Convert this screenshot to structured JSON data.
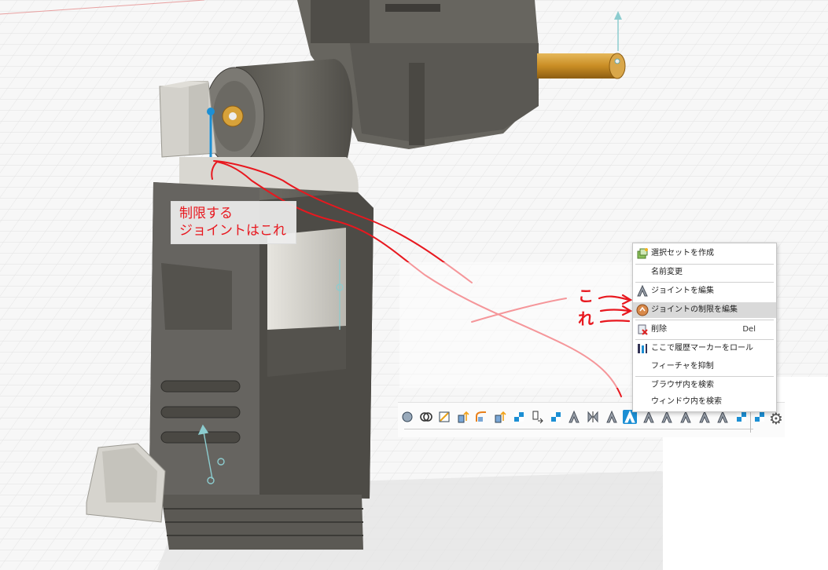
{
  "annotation": {
    "line1": "制限する",
    "line2": "ジョイントはこれ",
    "side_label_top": "こ",
    "side_label_bottom": "れ",
    "color": "#e8181f"
  },
  "context_menu": {
    "items": [
      {
        "label": "選択セットを作成",
        "icon": "selection-set-icon"
      },
      {
        "label": "名前変更",
        "icon": ""
      },
      {
        "label": "ジョイントを編集",
        "icon": "joint-icon"
      },
      {
        "label": "ジョイントの制限を編集",
        "icon": "joint-limits-icon",
        "highlighted": true
      },
      {
        "label": "削除",
        "shortcut": "Del",
        "icon": "delete-icon"
      },
      {
        "label": "ここで履歴マーカーをロール",
        "icon": "roll-marker-icon"
      },
      {
        "label": "フィーチャを抑制",
        "icon": ""
      },
      {
        "label": "ブラウザ内を検索",
        "icon": ""
      },
      {
        "label": "ウィンドウ内を検索",
        "icon": ""
      }
    ]
  },
  "timeline": {
    "icons": [
      "revolve-icon",
      "combine-icon",
      "sketch-icon",
      "extrude-icon",
      "fillet-icon",
      "extrude-icon",
      "joint-origin-icon",
      "move-icon",
      "joint-origin-icon",
      "joint-icon",
      "mirror-icon",
      "joint-icon",
      "joint-icon",
      "joint-icon",
      "joint-icon",
      "joint-icon",
      "joint-icon",
      "joint-icon",
      "joint-origin-icon",
      "joint-origin-icon"
    ],
    "selected_index": 12,
    "settings_icon": "gear-icon"
  },
  "colors": {
    "body_gray": "#5f5d57",
    "light_gray": "#d8d6d0",
    "brass": "#d7a23a",
    "selection_blue": "#1c8fd4",
    "grid": "#e6e6e6"
  }
}
